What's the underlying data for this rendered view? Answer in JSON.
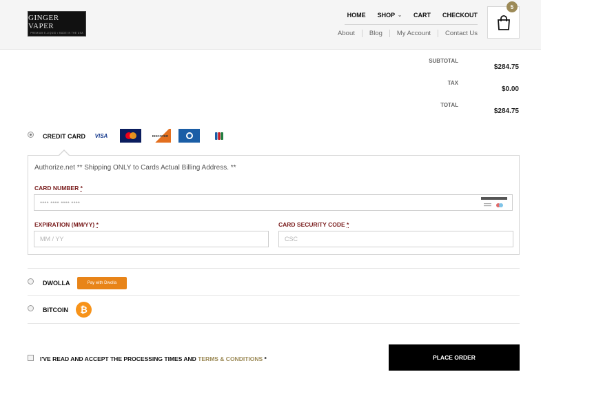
{
  "header": {
    "logo_text": "GINGER VAPER",
    "logo_tagline": "PREMIUM E-LIQUID • MADE IN THE USA",
    "primary_nav": [
      "HOME",
      "SHOP",
      "CART",
      "CHECKOUT"
    ],
    "secondary_nav": [
      "About",
      "Blog",
      "My Account",
      "Contact Us"
    ],
    "cart_count": "5"
  },
  "totals": {
    "subtotal_label": "SUBTOTAL",
    "subtotal_value": "$284.75",
    "tax_label": "TAX",
    "tax_value": "$0.00",
    "total_label": "TOTAL",
    "total_value": "$284.75"
  },
  "payment": {
    "credit_card": {
      "label": "CREDIT CARD",
      "card_logos": [
        {
          "name": "visa",
          "text": "VISA",
          "bg": "#ffffff",
          "fg": "#1a3d8f"
        },
        {
          "name": "mastercard",
          "text": "",
          "bg": "#0b1d5e",
          "fg": "#ffffff"
        },
        {
          "name": "discover",
          "text": "DISCOVER",
          "bg": "#ffffff",
          "fg": "#e36f1e"
        },
        {
          "name": "diners",
          "text": "",
          "bg": "#1b5ea6",
          "fg": "#ffffff"
        },
        {
          "name": "jcb",
          "text": "",
          "bg": "#ffffff",
          "fg": "#1b7a3b"
        }
      ],
      "description": "Authorize.net ** Shipping ONLY to Cards Actual Billing Address. **",
      "card_number_label": "CARD NUMBER",
      "card_number_placeholder": "•••• •••• •••• ••••",
      "expiration_label": "EXPIRATION (MM/YY)",
      "expiration_placeholder": "MM / YY",
      "csc_label": "CARD SECURITY CODE",
      "csc_placeholder": "CSC",
      "required_mark": "*"
    },
    "dwolla": {
      "label": "DWOLLA",
      "button_text": "Pay with Dwolla"
    },
    "bitcoin": {
      "label": "BITCOIN",
      "icon_glyph": "₿"
    }
  },
  "footer": {
    "terms_prefix": "I'VE READ AND ACCEPT THE PROCESSING TIMES AND ",
    "terms_link": "TERMS & CONDITIONS",
    "terms_required": " *",
    "place_order": "PLACE ORDER"
  },
  "colors": {
    "accent": "#9c8a57",
    "label_red": "#7a1d1d",
    "button_black": "#000000",
    "dwolla_orange": "#e88418",
    "bitcoin_orange": "#f7931a"
  }
}
